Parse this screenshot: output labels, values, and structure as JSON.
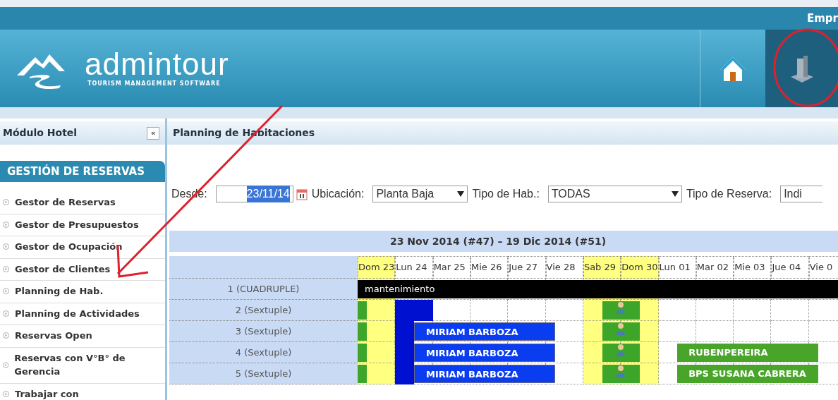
{
  "top_bar": {
    "text": "Empr"
  },
  "header": {
    "logo_text": "admintour",
    "logo_tagline": "TOURISM MANAGEMENT SOFTWARE",
    "buttons": [
      {
        "kind": "home",
        "selected": false
      },
      {
        "kind": "building",
        "selected": true
      }
    ]
  },
  "sidebar": {
    "title": "Módulo Hotel",
    "collapse_label": "«",
    "section": "GESTIÓN DE RESERVAS",
    "items": [
      {
        "label": "Gestor de Reservas"
      },
      {
        "label": "Gestor de Presupuestos"
      },
      {
        "label": "Gestor de Ocupación"
      },
      {
        "label": "Gestor de Clientes"
      },
      {
        "label": "Planning de Hab."
      },
      {
        "label": "Planning de Actividades"
      },
      {
        "label": "Reservas Open"
      },
      {
        "label": "Reservas con V°B° de Gerencia"
      },
      {
        "label": "Trabajar con"
      }
    ]
  },
  "panel": {
    "title": "Planning de Habitaciones"
  },
  "filters": [
    {
      "kind": "date",
      "label": "Desde:",
      "value": "23/11/14",
      "highlighted": true
    },
    {
      "kind": "select",
      "label": "Ubicación:",
      "value": "Planta Baja"
    },
    {
      "kind": "select",
      "label": "Tipo de Hab.:",
      "value": "TODAS"
    },
    {
      "kind": "select",
      "label": "Tipo de Reserva:",
      "value": "Indi"
    }
  ],
  "planning": {
    "range": "23 Nov 2014 (#47) – 19 Dic 2014 (#51)",
    "days": [
      {
        "label": "Dom 23",
        "weekend": true
      },
      {
        "label": "Lun 24",
        "weekend": false
      },
      {
        "label": "Mar 25",
        "weekend": false
      },
      {
        "label": "Mie 26",
        "weekend": false
      },
      {
        "label": "Jue 27",
        "weekend": false
      },
      {
        "label": "Vie 28",
        "weekend": false
      },
      {
        "label": "Sab 29",
        "weekend": true
      },
      {
        "label": "Dom 30",
        "weekend": true
      },
      {
        "label": "Lun 01",
        "weekend": false
      },
      {
        "label": "Mar 02",
        "weekend": false
      },
      {
        "label": "Mie 03",
        "weekend": false
      },
      {
        "label": "Jue 04",
        "weekend": false
      },
      {
        "label": "Vie 0",
        "weekend": false
      }
    ],
    "rooms": [
      {
        "name": "1 (CUADRUPLE)",
        "bookings": [
          {
            "kind": "maintenance",
            "text": "mantenimiento"
          }
        ]
      },
      {
        "name": "2 (Sextuple)",
        "bookings": [
          {
            "kind": "block"
          },
          {
            "kind": "column"
          },
          {
            "kind": "guest"
          }
        ]
      },
      {
        "name": "3 (Sextuple)",
        "bookings": [
          {
            "kind": "block"
          },
          {
            "kind": "column"
          },
          {
            "kind": "reservation",
            "text": "MIRIAM BARBOZA"
          },
          {
            "kind": "guest"
          }
        ]
      },
      {
        "name": "4 (Sextuple)",
        "bookings": [
          {
            "kind": "block"
          },
          {
            "kind": "column"
          },
          {
            "kind": "reservation",
            "text": "MIRIAM BARBOZA"
          },
          {
            "kind": "guest"
          },
          {
            "kind": "confirmed",
            "text": "RUBENPEREIRA"
          }
        ]
      },
      {
        "name": "5 (Sextuple)",
        "bookings": [
          {
            "kind": "block"
          },
          {
            "kind": "column"
          },
          {
            "kind": "reservation",
            "text": "MIRIAM BARBOZA"
          },
          {
            "kind": "guest"
          },
          {
            "kind": "confirmed",
            "text": "BPS SUSANA CABRERA"
          }
        ]
      }
    ]
  },
  "annotations": {
    "arrow": true,
    "circle": true
  }
}
